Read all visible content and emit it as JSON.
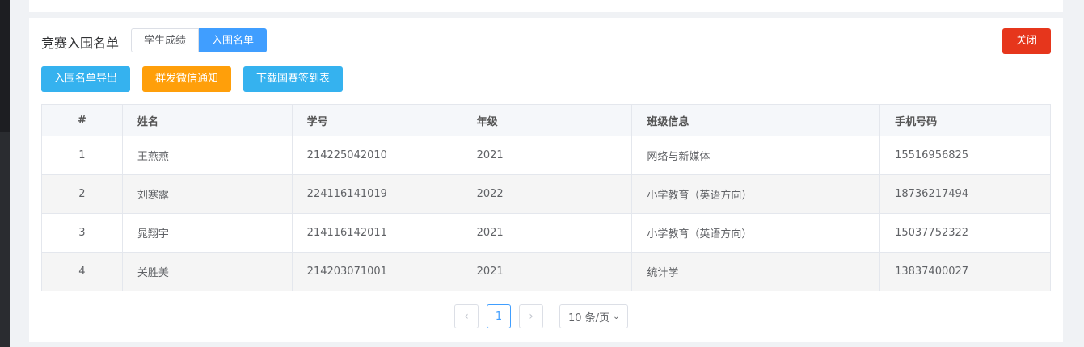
{
  "header": {
    "title": "竞赛入围名单",
    "tabs": [
      "学生成绩",
      "入围名单"
    ],
    "active_tab": "入围名单",
    "close_label": "关闭"
  },
  "actions": {
    "export_label": "入围名单导出",
    "wechat_label": "群发微信通知",
    "download_label": "下载国赛签到表"
  },
  "table": {
    "columns": [
      "#",
      "姓名",
      "学号",
      "年级",
      "班级信息",
      "手机号码"
    ],
    "rows": [
      [
        "1",
        "王燕燕",
        "214225042010",
        "2021",
        "网络与新媒体",
        "15516956825"
      ],
      [
        "2",
        "刘寒露",
        "224116141019",
        "2022",
        "小学教育（英语方向）",
        "18736217494"
      ],
      [
        "3",
        "晁翔宇",
        "214116142011",
        "2021",
        "小学教育（英语方向）",
        "15037752322"
      ],
      [
        "4",
        "关胜美",
        "214203071001",
        "2021",
        "统计学",
        "13837400027"
      ]
    ]
  },
  "pagination": {
    "current_page": "1",
    "page_size_label": "10 条/页",
    "prev_icon": "‹",
    "next_icon": "›"
  },
  "colors": {
    "primary": "#409eff",
    "export_blue": "#35b2ef",
    "wechat_orange": "#ff9f0a",
    "close_red": "#e6361c"
  }
}
